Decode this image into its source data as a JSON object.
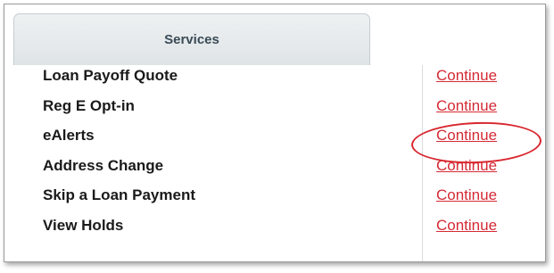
{
  "tab": {
    "label": "Services"
  },
  "services": [
    {
      "label": "Loan Payoff Quote",
      "action": "Continue"
    },
    {
      "label": "Reg E Opt-in",
      "action": "Continue"
    },
    {
      "label": "eAlerts",
      "action": "Continue"
    },
    {
      "label": "Address Change",
      "action": "Continue"
    },
    {
      "label": "Skip a Loan Payment",
      "action": "Continue"
    },
    {
      "label": "View Holds",
      "action": "Continue"
    }
  ],
  "colors": {
    "link": "#d42a35",
    "highlight": "#d8262e",
    "tab_text": "#3a4b57"
  }
}
